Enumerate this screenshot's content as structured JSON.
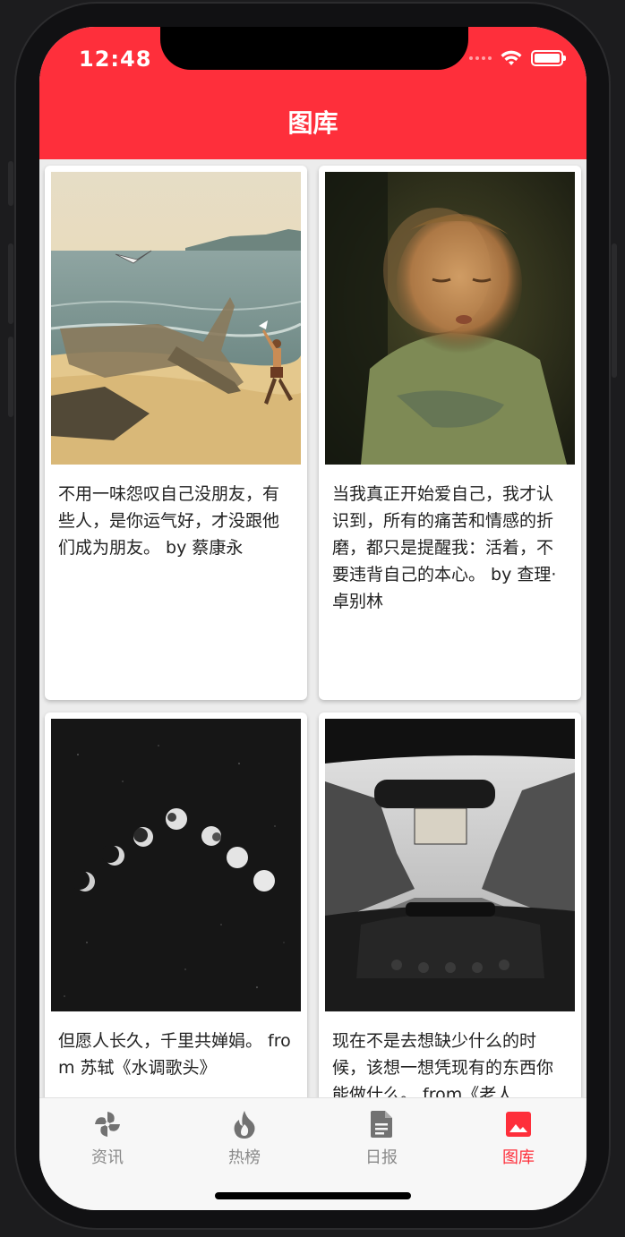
{
  "status_bar": {
    "time": "12:48"
  },
  "header": {
    "title": "图库"
  },
  "cards": [
    {
      "image": "beach-airplane-illustration",
      "caption": "不用一味怨叹自己没朋友，有些人，是你运气好，才没跟他们成为朋友。 by 蔡康永"
    },
    {
      "image": "blurred-child-photo",
      "caption": "当我真正开始爱自己，我才认识到，所有的痛苦和情感的折磨，都只是提醒我：活着，不要违背自己的本心。 by 查理·卓别林"
    },
    {
      "image": "moon-phases-photo",
      "caption": "但愿人长久，千里共婵娟。 from 苏轼《水调歌头》"
    },
    {
      "image": "car-windshield-photo",
      "caption": "现在不是去想缺少什么的时候，该想一想凭现有的东西你能做什么。 from《老人"
    }
  ],
  "tabbar": {
    "items": [
      {
        "label": "资讯",
        "icon": "pinwheel-icon",
        "active": false
      },
      {
        "label": "热榜",
        "icon": "flame-icon",
        "active": false
      },
      {
        "label": "日报",
        "icon": "document-icon",
        "active": false
      },
      {
        "label": "图库",
        "icon": "image-icon",
        "active": true
      }
    ],
    "active_color": "#fe2f3b",
    "inactive_color": "#8a8a8a"
  },
  "colors": {
    "header": "#fe2f3b",
    "background": "#ececec"
  }
}
